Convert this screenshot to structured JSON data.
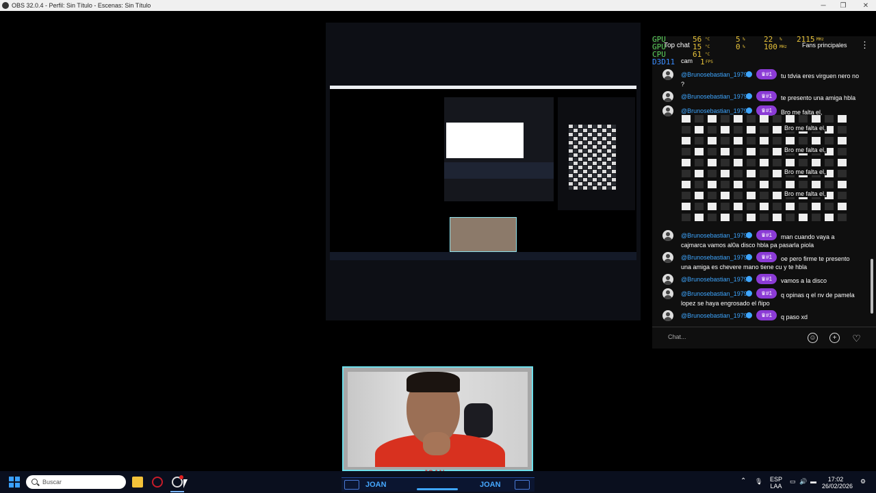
{
  "window": {
    "title": "OBS 32.0.4 - Perfil: Sin Título - Escenas: Sin Título",
    "minimize": "─",
    "restore": "❐",
    "close": "✕"
  },
  "hw_monitor": {
    "rows": [
      {
        "label": "GPU",
        "v1": "56",
        "u1": "°C",
        "v2": "5",
        "u2": "%",
        "v3": "22",
        "u3": "%",
        "v4": "2115",
        "u4": "MHz"
      },
      {
        "label": "GPU",
        "v1": "15",
        "u1": "°C",
        "v2": "0",
        "u2": "%",
        "v3": "100",
        "u3": "MHz",
        "v4": "",
        "u4": ""
      },
      {
        "label": "CPU",
        "v1": "61",
        "u1": "°C",
        "v2": "",
        "u2": "",
        "v3": "",
        "u3": "",
        "v4": "",
        "u4": ""
      },
      {
        "label": "D3D11",
        "v1": "1",
        "u1": "FPS",
        "v2": "",
        "u2": "",
        "v3": "",
        "u3": "",
        "v4": "",
        "u4": ""
      }
    ]
  },
  "chat": {
    "header_title": "Top chat",
    "header_sub": "cam",
    "fans_label": "Fans principales",
    "badge_label": "#1",
    "messages": [
      {
        "user": "@Brunosebastian_1979",
        "text": "tu tdvia eres virguen nero no",
        "cont": "?"
      },
      {
        "user": "@Brunosebastian_1979",
        "text": "te presento una amiga hbla",
        "cont": ""
      },
      {
        "user": "@Brunosebastian_1979",
        "text": "Bro me falta el,",
        "cont": ""
      },
      {
        "user": "@Brunosebastian_1979",
        "text": "man cuando vaya a",
        "cont": "cajmarca vamos al0a disco hbla pa pasarla piola"
      },
      {
        "user": "@Brunosebastian_1979",
        "text": "oe pero firme te presento",
        "cont": "una amiga es chevere mano tiene cu y te hbla"
      },
      {
        "user": "@Brunosebastian_1979",
        "text": "vamos a la disco",
        "cont": ""
      },
      {
        "user": "@Brunosebastian_1979",
        "text": "q opinas q el nv de pamela",
        "cont": "lopez se haya engrosado el ñipo"
      },
      {
        "user": "@Brunosebastian_1979",
        "text": "q paso xd",
        "cont": ""
      }
    ],
    "repeat_text": "Bro me falta el,",
    "input_placeholder": "Chat..."
  },
  "webcam": {
    "name_label": "JOAN"
  },
  "overlay": {
    "left_name": "JOAN",
    "right_name": "JOAN"
  },
  "taskbar": {
    "search_placeholder": "Buscar",
    "lang_top": "ESP",
    "lang_bottom": "LAA",
    "time": "17:02",
    "date": "26/02/2026"
  },
  "colors": {
    "accent_blue": "#3ea6ff",
    "badge_purple": "#8b3bd6",
    "cam_border": "#6ee0ec",
    "name_red": "#e0322f"
  }
}
